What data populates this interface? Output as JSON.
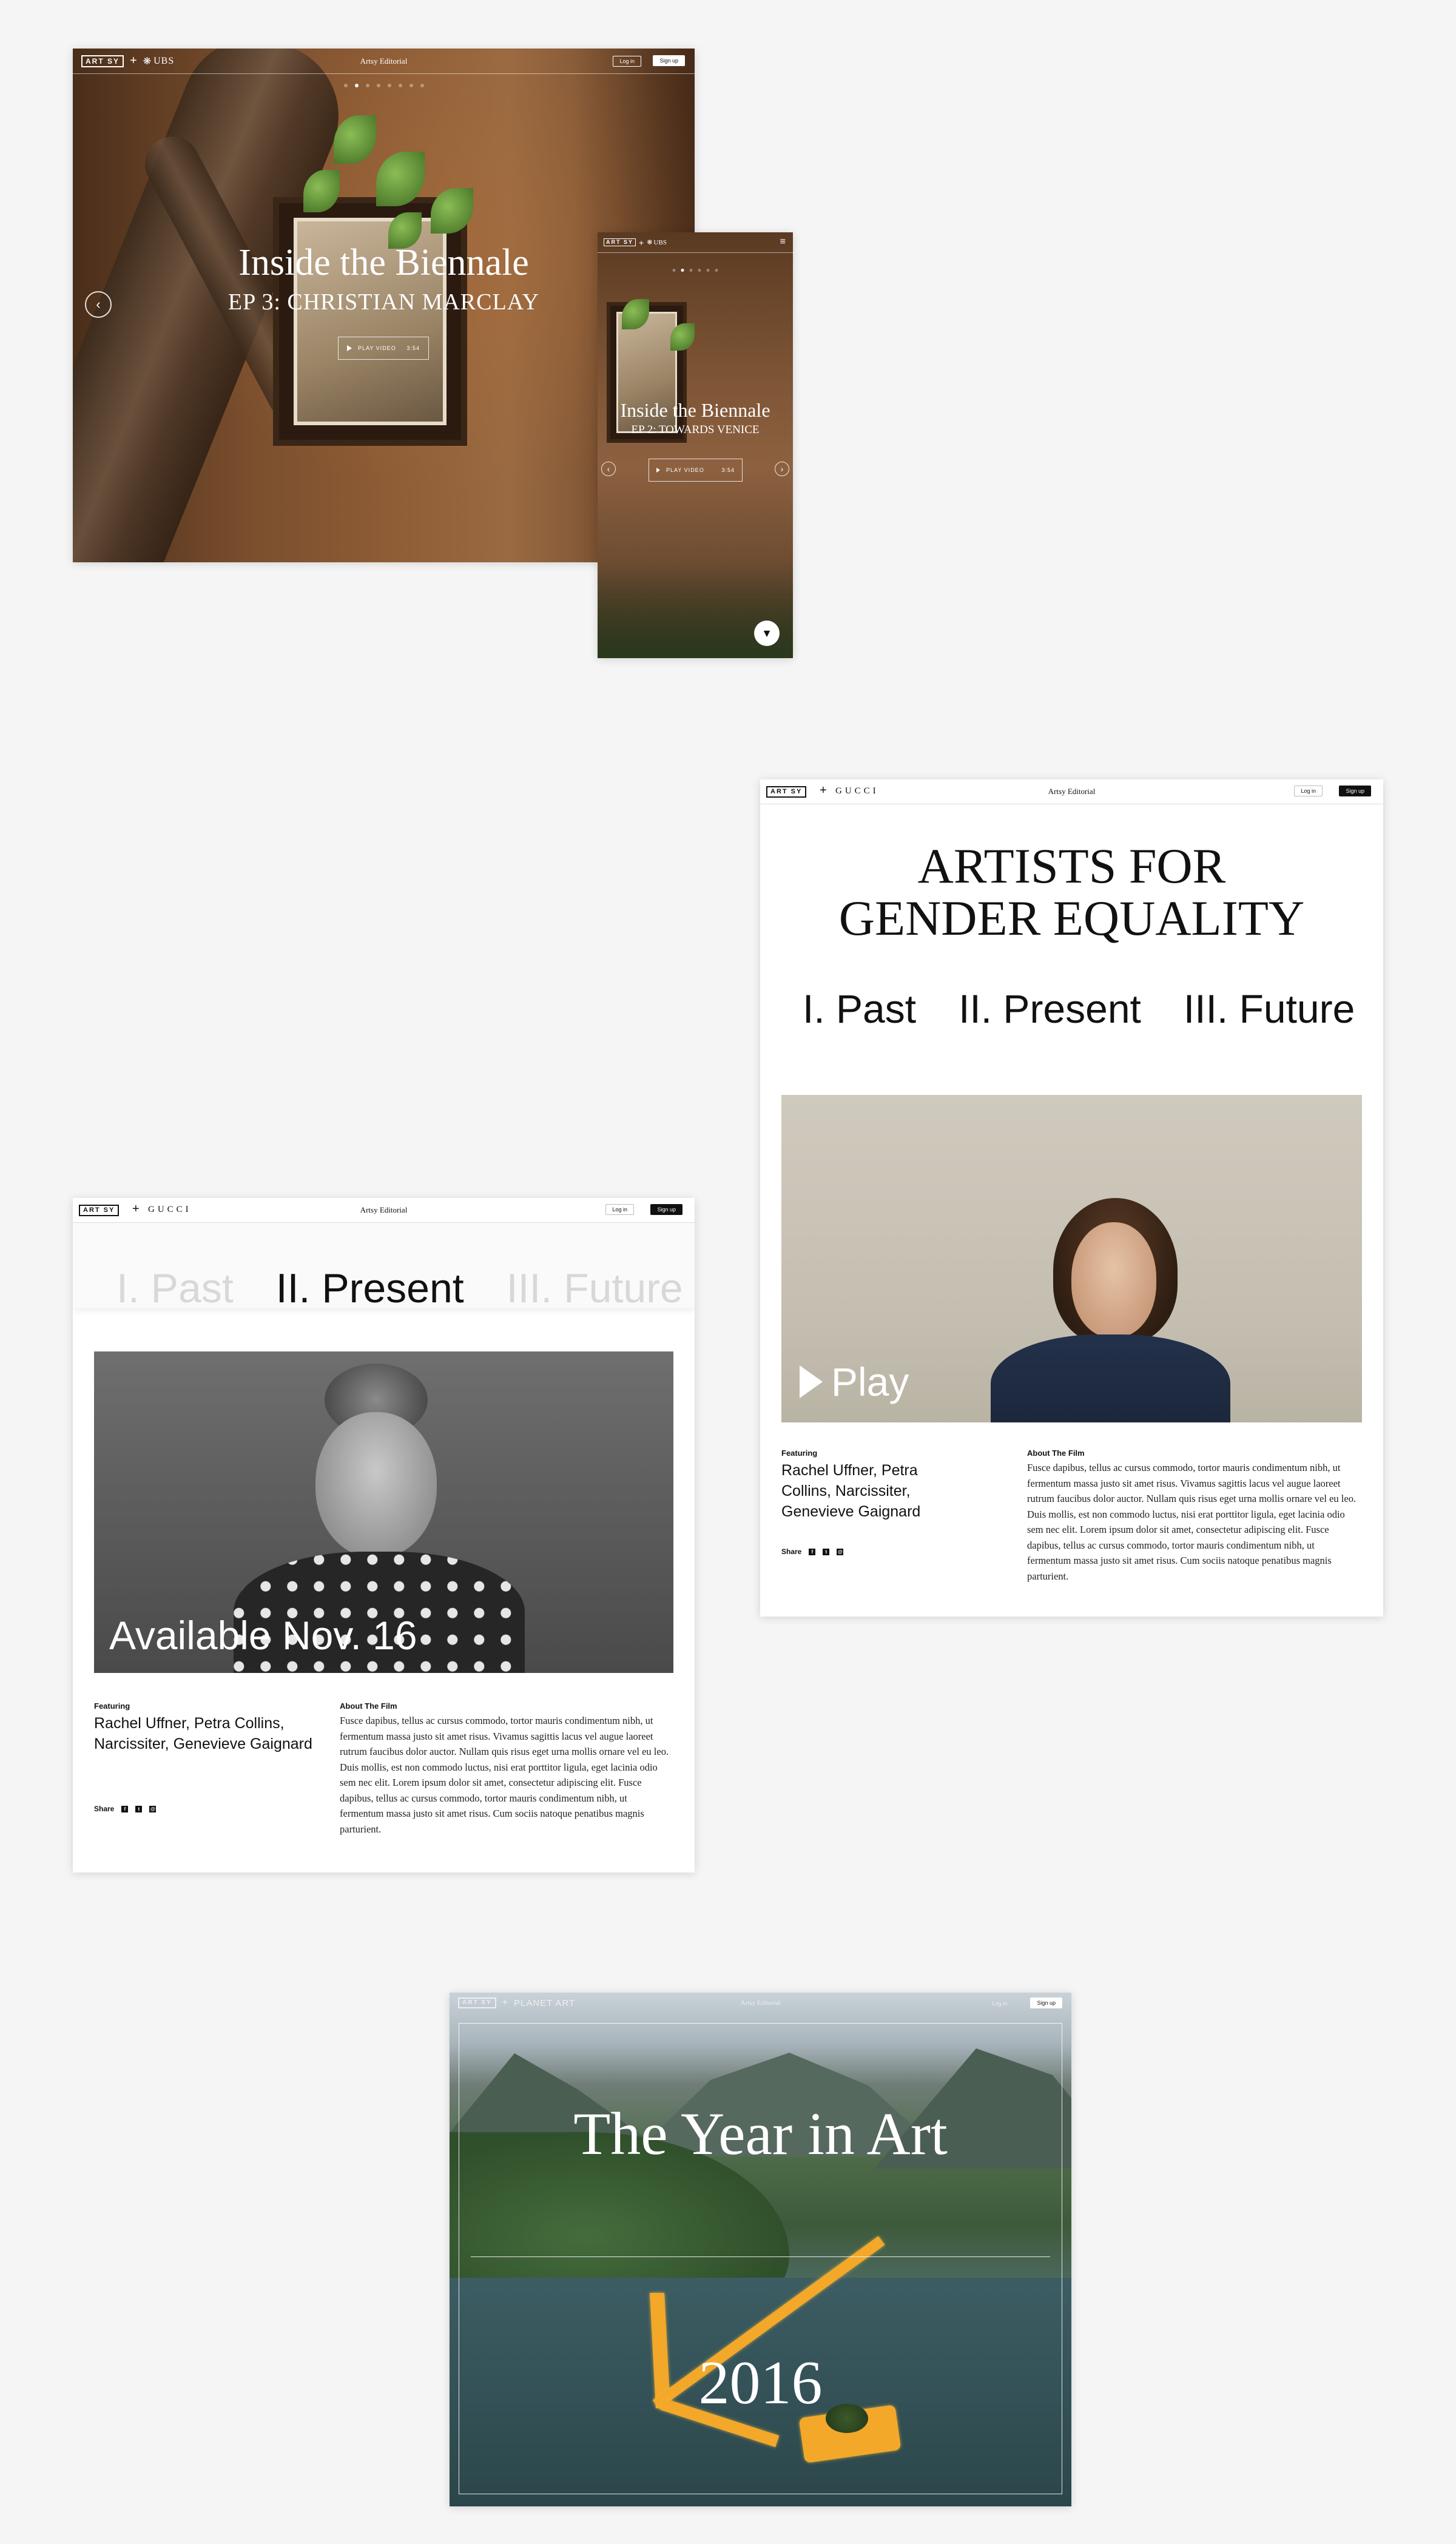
{
  "ubs_desktop": {
    "logo": "ART SY",
    "partner": "UBS",
    "nav_center": "Artsy Editorial",
    "login": "Log in",
    "signup": "Sign up",
    "title": "Inside the Biennale",
    "subtitle": "EP 3: CHRISTIAN MARCLAY",
    "play_label": "PLAY VIDEO",
    "duration": "3:54",
    "slide_count": 8,
    "active_slide": 3
  },
  "ubs_mobile": {
    "logo": "ART SY",
    "partner": "UBS",
    "title": "Inside the Biennale",
    "subtitle": "EP 2: TOWARDS VENICE",
    "play_label": "PLAY VIDEO",
    "duration": "3:54",
    "menu_icon": "hamburger-icon"
  },
  "gucci_right": {
    "logo": "ART SY",
    "partner": "GUCCI",
    "nav_center": "Artsy Editorial",
    "login": "Log in",
    "signup": "Sign up",
    "headline_line1": "ARTISTS FOR",
    "headline_line2": "GENDER EQUALITY",
    "parts": [
      "I. Past",
      "II. Present",
      "III. Future"
    ],
    "play_label": "Play",
    "featuring_label": "Featuring",
    "featuring_names": "Rachel Uffner, Petra Collins, Narcissiter, Genevieve Gaignard",
    "about_label": "About The Film",
    "about_text": "Fusce dapibus, tellus ac cursus commodo, tortor mauris condimentum nibh, ut fermentum massa justo sit amet risus. Vivamus sagittis lacus vel augue laoreet rutrum faucibus dolor auctor. Nullam quis risus eget urna mollis ornare vel eu leo. Duis mollis, est non commodo luctus, nisi erat porttitor ligula, eget lacinia odio sem nec elit. Lorem ipsum dolor sit amet, consectetur adipiscing elit. Fusce dapibus, tellus ac cursus commodo, tortor mauris condimentum nibh, ut fermentum massa justo sit amet risus. Cum sociis natoque penatibus magnis parturient.",
    "share_label": "Share"
  },
  "gucci_left": {
    "logo": "ART SY",
    "partner": "GUCCI",
    "nav_center": "Artsy Editorial",
    "login": "Log in",
    "signup": "Sign up",
    "parts": [
      "I. Past",
      "II. Present",
      "III. Future"
    ],
    "available_label": "Available Nov. 16",
    "featuring_label": "Featuring",
    "featuring_names": "Rachel Uffner, Petra Collins, Narcissiter, Genevieve Gaignard",
    "about_label": "About The Film",
    "about_text": "Fusce dapibus, tellus ac cursus commodo, tortor mauris condimentum nibh, ut fermentum massa justo sit amet risus. Vivamus sagittis lacus vel augue laoreet rutrum faucibus dolor auctor. Nullam quis risus eget urna mollis ornare vel eu leo. Duis mollis, est non commodo luctus, nisi erat porttitor ligula, eget lacinia odio sem nec elit. Lorem ipsum dolor sit amet, consectetur adipiscing elit. Fusce dapibus, tellus ac cursus commodo, tortor mauris condimentum nibh, ut fermentum massa justo sit amet risus. Cum sociis natoque penatibus magnis parturient.",
    "share_label": "Share"
  },
  "year_in_art": {
    "logo": "ART SY",
    "partner": "PLANET ART",
    "nav_center": "Artsy Editorial",
    "login": "Log in",
    "signup": "Sign up",
    "title": "The Year in Art",
    "year": "2016"
  }
}
